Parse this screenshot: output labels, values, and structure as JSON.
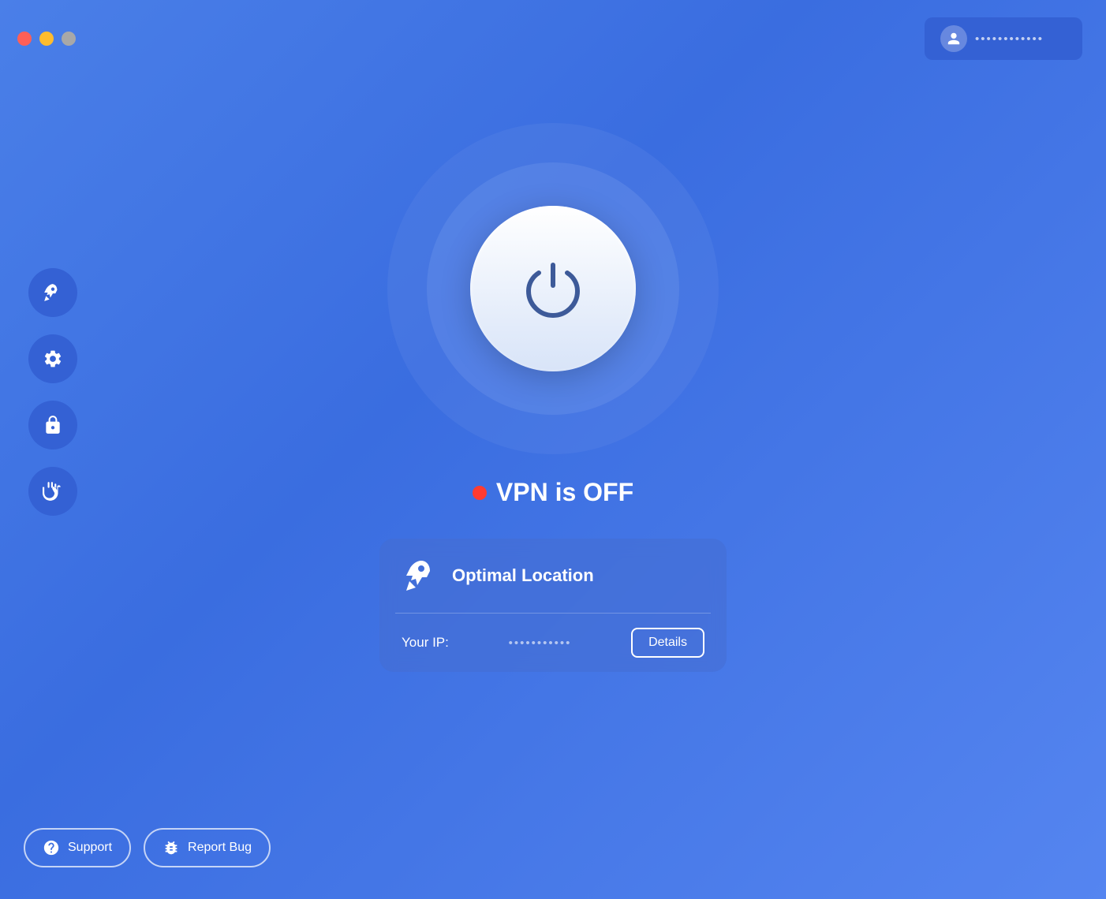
{
  "window": {
    "close_label": "close",
    "minimize_label": "minimize",
    "maximize_label": "maximize"
  },
  "header": {
    "user_email": "••••••••••••"
  },
  "sidebar": {
    "items": [
      {
        "id": "speed",
        "icon": "rocket-icon",
        "label": "Speed"
      },
      {
        "id": "settings",
        "icon": "gear-icon",
        "label": "Settings"
      },
      {
        "id": "security",
        "icon": "lock-icon",
        "label": "Security"
      },
      {
        "id": "privacy",
        "icon": "hand-icon",
        "label": "Privacy"
      }
    ]
  },
  "main": {
    "vpn_status": "VPN is OFF",
    "status_color": "#ff3b30",
    "location": {
      "name": "Optimal Location",
      "ip_label": "Your IP:",
      "ip_value": "•••••••••••",
      "details_label": "Details"
    }
  },
  "footer": {
    "support_label": "Support",
    "report_bug_label": "Report Bug"
  }
}
